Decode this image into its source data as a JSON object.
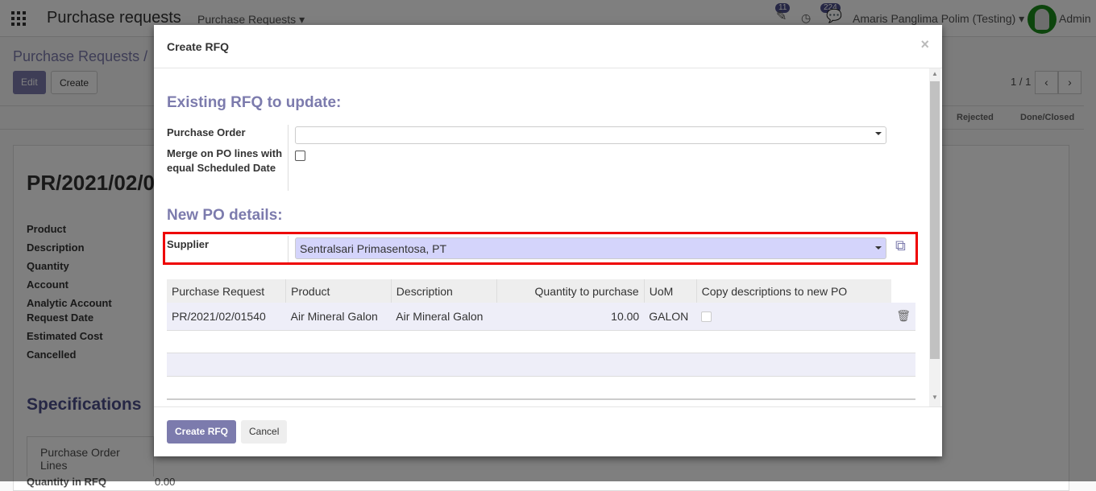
{
  "navbar": {
    "app_title": "Purchase requests",
    "menu": "Purchase Requests",
    "activity_count": "11",
    "message_count": "224",
    "company": "Amaris Panglima Polim (Testing)",
    "user": "Admin"
  },
  "page": {
    "breadcrumb": "Purchase Requests /",
    "edit_label": "Edit",
    "create_label": "Create",
    "pager": "1 / 1",
    "stages": [
      "Rejected",
      "Done/Closed"
    ],
    "record_title": "PR/2021/02/0",
    "fields": [
      "Product",
      "Description",
      "Quantity",
      "Account",
      "Analytic Account",
      "Request Date",
      "Estimated Cost",
      "Cancelled"
    ],
    "section": "Specifications",
    "tab": "Purchase Order Lines",
    "quantity_in_rfq_label": "Quantity in RFQ",
    "quantity_in_rfq": "0.00"
  },
  "modal": {
    "title": "Create RFQ",
    "existing_heading": "Existing RFQ to update:",
    "purchase_order_label": "Purchase Order",
    "purchase_order_value": "",
    "merge_label": "Merge on PO lines with equal Scheduled Date",
    "merge_checked": false,
    "new_heading": "New PO details:",
    "supplier_label": "Supplier",
    "supplier_value": "Sentralsari Primasentosa, PT",
    "columns": [
      "Purchase Request",
      "Product",
      "Description",
      "Quantity to purchase",
      "UoM",
      "Copy descriptions to new PO"
    ],
    "rows": [
      {
        "purchase_request": "PR/2021/02/01540",
        "product": "Air Mineral Galon",
        "description": "Air Mineral Galon",
        "quantity": "10.00",
        "uom": "GALON",
        "copy_desc": false
      }
    ],
    "create_label": "Create RFQ",
    "cancel_label": "Cancel"
  },
  "colors": {
    "primary": "#7c7bad",
    "highlight": "#e00000",
    "supplier_bg": "#d4d4fb"
  }
}
